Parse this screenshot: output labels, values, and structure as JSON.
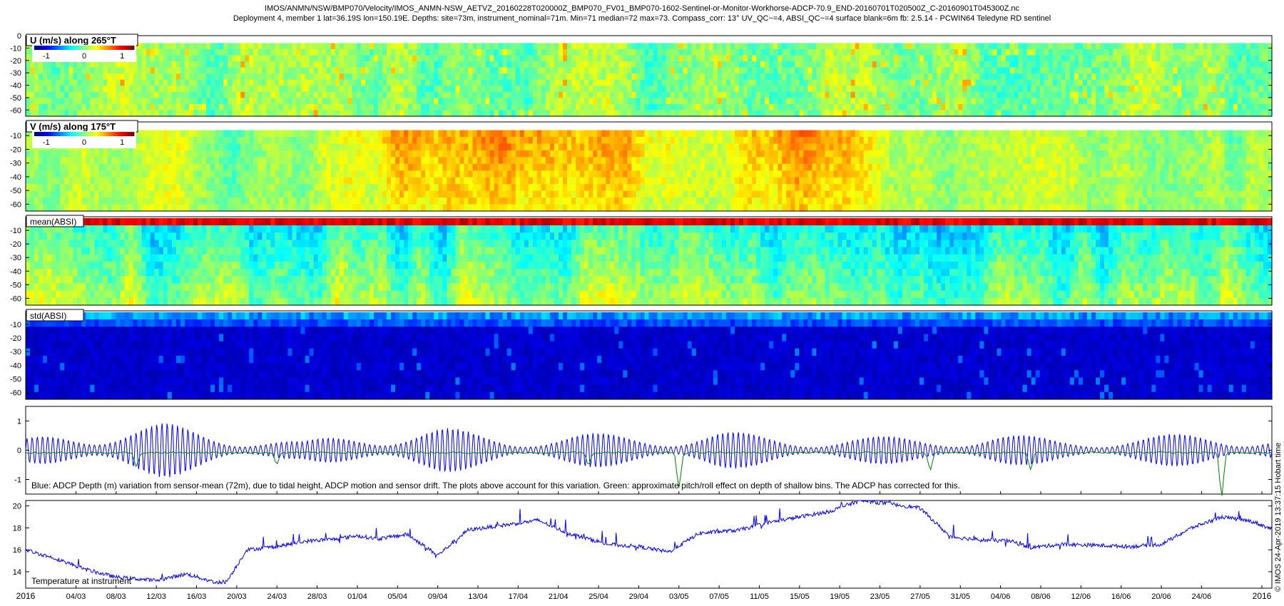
{
  "title": {
    "line1": "IMOS/ANMN/NSW/BMP070/Velocity/IMOS_ANMN-NSW_AETVZ_20160228T020000Z_BMP070_FV01_BMP070-1602-Sentinel-or-Monitor-Workhorse-ADCP-70.9_END-20160701T020500Z_C-20160901T045300Z.nc",
    "line2": "Deployment 4, member 1 lat=36.19S lon=150.19E. Depths: site=73m, instrument_nominal=71m. Min=71 median=72 max=73. Compass_corr: 13° UV_QC~=4, ABSI_QC~=4 surface blank=6m fb: 2.5.14 - PCWIN64 Teledyne RD sentinel"
  },
  "side_label": "© IMOS 24-Apr-2019 13:37:15 Hobart time",
  "colors": {
    "blue_line": "#0000ff",
    "green_line": "#007f00",
    "colormap": [
      "#00007f",
      "#0000ff",
      "#007fff",
      "#00ffff",
      "#7fff7f",
      "#ffff00",
      "#ff7f00",
      "#ff0000",
      "#7f0000"
    ]
  },
  "chart_data": [
    {
      "type": "heatmap",
      "title": "U (m/s) along 265°T",
      "colorbar_ticks": [
        "-1",
        "0",
        "1"
      ],
      "clim": [
        -1.3,
        1.3
      ],
      "ylim": [
        -65,
        0
      ],
      "yticks": [
        0,
        -10,
        -20,
        -30,
        -40,
        -50,
        -60
      ],
      "xlim": [
        "2016-02-28",
        "2016-07-01"
      ],
      "rows_top_depth": -6,
      "mean_value": 0.0,
      "description_level": "mostly near 0"
    },
    {
      "type": "heatmap",
      "title": "V (m/s) along 175°T",
      "colorbar_ticks": [
        "-1",
        "0",
        "1"
      ],
      "clim": [
        -1.3,
        1.3
      ],
      "ylim": [
        -65,
        0
      ],
      "yticks": [
        -10,
        -20,
        -30,
        -40,
        -50,
        -60
      ],
      "xlim": [
        "2016-02-28",
        "2016-07-01"
      ],
      "rows_top_depth": -6
    },
    {
      "type": "heatmap",
      "title": "mean(ABSI)",
      "ylim": [
        -65,
        0
      ],
      "yticks": [
        -10,
        -20,
        -30,
        -40,
        -50,
        -60
      ],
      "xlim": [
        "2016-02-28",
        "2016-07-01"
      ]
    },
    {
      "type": "heatmap",
      "title": "std(ABSI)",
      "ylim": [
        -65,
        0
      ],
      "yticks": [
        -10,
        -20,
        -30,
        -40,
        -50,
        -60
      ],
      "xlim": [
        "2016-02-28",
        "2016-07-01"
      ]
    },
    {
      "type": "line",
      "title": "",
      "annotation": "Blue: ADCP Depth (m) variation from sensor-mean (72m), due to tidal height, ADCP motion and sensor drift. The plots above account for this variation. Green: approximate pitch/roll effect on depth of shallow bins. The ADCP has corrected for this.",
      "ylim": [
        -1.5,
        1.5
      ],
      "yticks": [
        1,
        0,
        -1
      ],
      "xlim": [
        "2016-02-28",
        "2016-07-01"
      ],
      "series": [
        {
          "color": "#0000ff",
          "tidal_amplitude_by_week": [
            0.4,
            0.9,
            0.95,
            0.6,
            0.3,
            0.75,
            0.8,
            0.5,
            0.6,
            0.55,
            0.7,
            0.45,
            0.5,
            0.45,
            0.6,
            0.4,
            0.5,
            0.6,
            0.55
          ]
        },
        {
          "color": "#007f00",
          "dips": [
            [
              "2016-03-10",
              -0.5
            ],
            [
              "2016-03-24",
              -0.4
            ],
            [
              "2016-04-24",
              -0.45
            ],
            [
              "2016-05-03",
              -1.2
            ],
            [
              "2016-05-28",
              -0.6
            ],
            [
              "2016-06-07",
              -0.6
            ],
            [
              "2016-06-26",
              -1.5
            ]
          ]
        }
      ]
    },
    {
      "type": "line",
      "annotation": "Temperature at instrument",
      "ylim": [
        12.5,
        20.5
      ],
      "yticks": [
        20,
        18,
        16,
        14
      ],
      "xlim": [
        "2016-02-28",
        "2016-07-01"
      ],
      "series": [
        {
          "color": "#0000ff",
          "x": [
            "2016-02-28",
            "2016-03-02",
            "2016-03-05",
            "2016-03-08",
            "2016-03-12",
            "2016-03-15",
            "2016-03-18",
            "2016-03-19",
            "2016-03-21",
            "2016-03-24",
            "2016-03-27",
            "2016-03-30",
            "2016-04-01",
            "2016-04-03",
            "2016-04-06",
            "2016-04-09",
            "2016-04-12",
            "2016-04-16",
            "2016-04-19",
            "2016-04-22",
            "2016-04-26",
            "2016-04-29",
            "2016-05-02",
            "2016-05-05",
            "2016-05-09",
            "2016-05-12",
            "2016-05-15",
            "2016-05-18",
            "2016-05-21",
            "2016-05-24",
            "2016-05-27",
            "2016-05-30",
            "2016-06-02",
            "2016-06-05",
            "2016-06-07",
            "2016-06-10",
            "2016-06-14",
            "2016-06-17",
            "2016-06-20",
            "2016-06-23",
            "2016-06-26",
            "2016-06-29",
            "2016-07-01"
          ],
          "y": [
            16.0,
            15.2,
            14.2,
            13.5,
            13.2,
            13.8,
            13.0,
            13.1,
            16.0,
            16.3,
            16.8,
            17.0,
            17.3,
            17.0,
            17.4,
            15.5,
            17.8,
            18.3,
            18.7,
            17.5,
            16.5,
            16.3,
            15.8,
            17.5,
            17.8,
            18.5,
            19.0,
            19.5,
            20.5,
            20.2,
            19.8,
            17.2,
            16.9,
            16.8,
            16.2,
            16.5,
            16.4,
            16.3,
            16.5,
            18.0,
            19.0,
            18.6,
            17.9
          ]
        }
      ]
    }
  ],
  "xticks": [
    "2016",
    "04/03",
    "08/03",
    "12/03",
    "16/03",
    "20/03",
    "24/03",
    "28/03",
    "01/04",
    "05/04",
    "09/04",
    "13/04",
    "17/04",
    "21/04",
    "25/04",
    "29/04",
    "03/05",
    "07/05",
    "11/05",
    "15/05",
    "19/05",
    "23/05",
    "27/05",
    "31/05",
    "04/06",
    "08/06",
    "12/06",
    "16/06",
    "20/06",
    "24/06",
    "2016"
  ]
}
